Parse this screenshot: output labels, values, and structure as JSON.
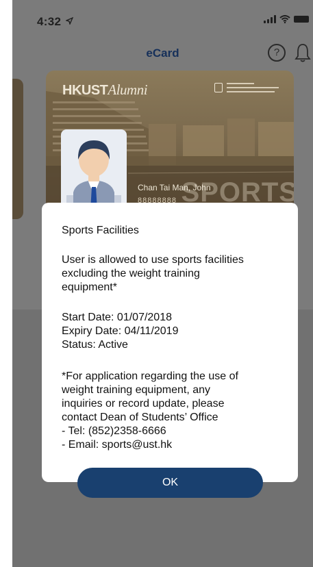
{
  "status_bar": {
    "time": "4:32"
  },
  "nav": {
    "title": "eCard",
    "help_symbol": "?"
  },
  "card": {
    "brand": "HKUST",
    "brand_suffix": "Alumni",
    "holder_name": "Chan Tai Man, John",
    "holder_id": "88888888",
    "watermark": "SPORTS"
  },
  "dialog": {
    "title": "Sports Facilities",
    "body_lines": [
      "User is allowed to use sports facilities",
      "excluding the weight training",
      "equipment*"
    ],
    "start_date": "Start Date: 01/07/2018",
    "expiry_date": "Expiry Date: 04/11/2019",
    "status": "Status: Active",
    "note_lines": [
      "*For application regarding the use of",
      "weight training equipment, any",
      "inquiries or record update, please",
      "contact Dean of Students’ Office",
      "- Tel: (852)2358-6666",
      "- Email: sports@ust.hk"
    ],
    "ok_label": "OK"
  },
  "colors": {
    "accent": "#19406f",
    "overlay": "#7a7a7a",
    "dialog_bg": "#ffffff",
    "title_text": "#16305a"
  },
  "icons": {
    "location": "location-arrow-icon",
    "signal": "cellular-signal-icon",
    "wifi": "wifi-icon",
    "battery": "battery-icon",
    "help": "help-icon",
    "notifications": "bell-icon"
  }
}
